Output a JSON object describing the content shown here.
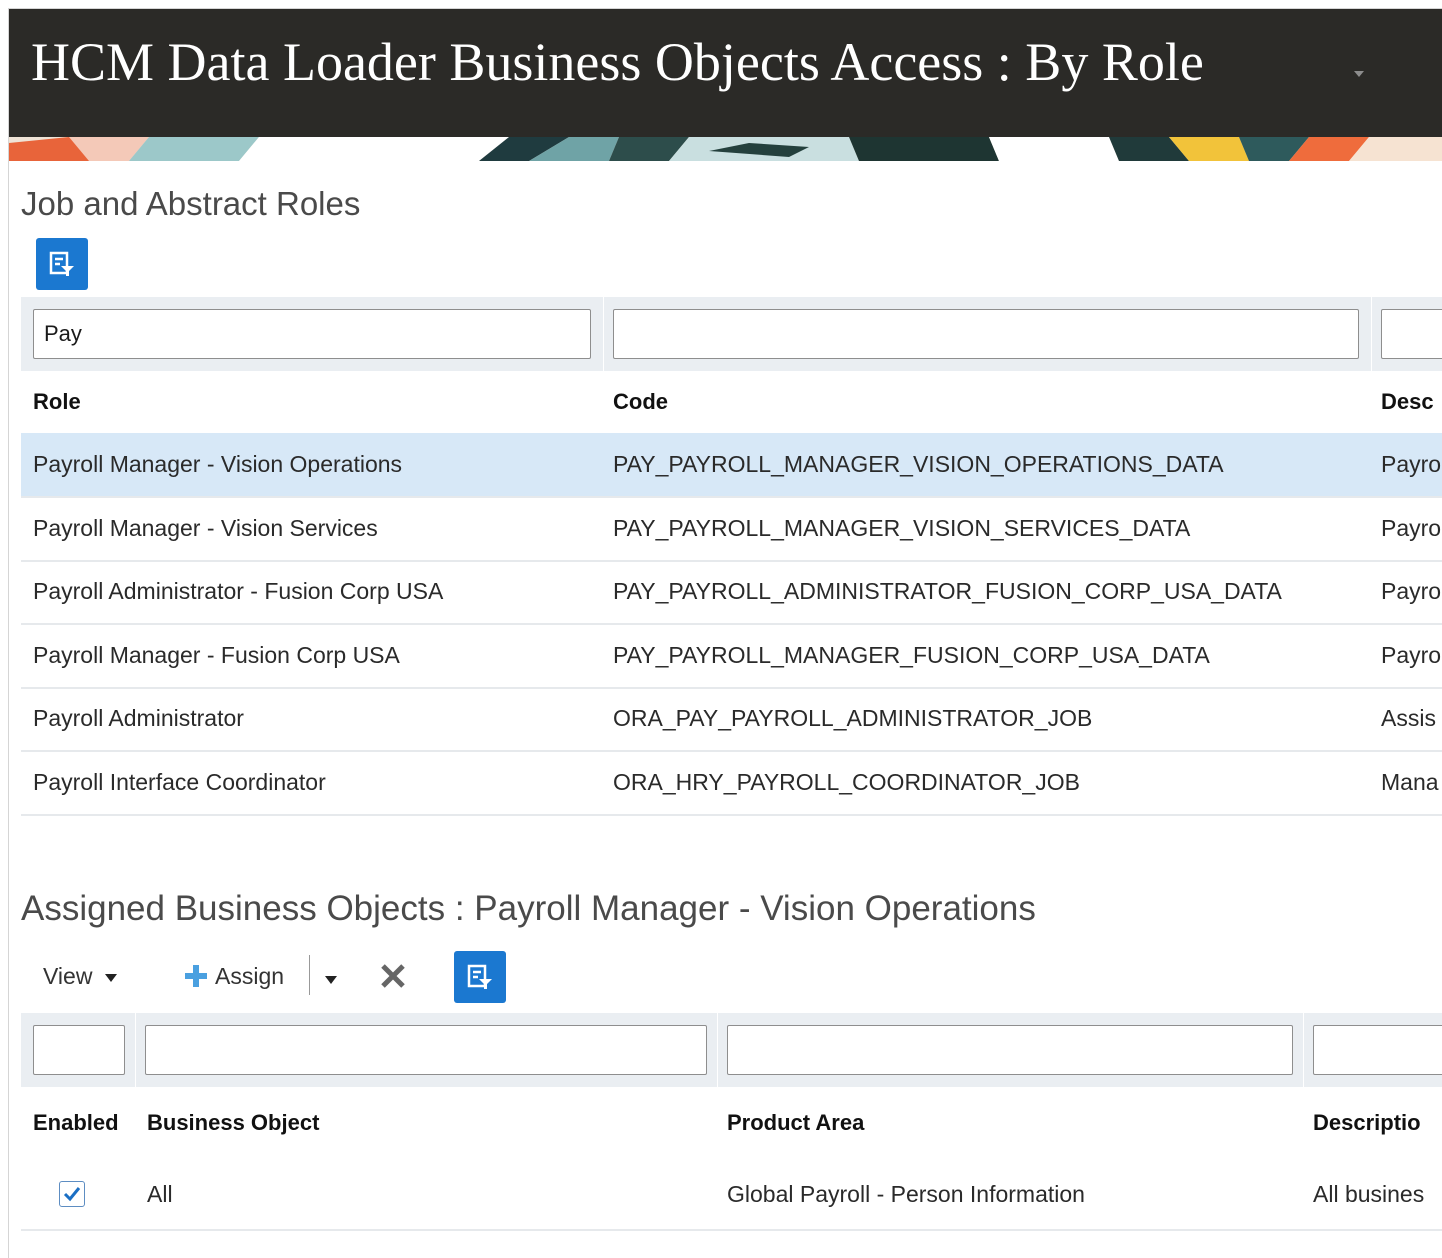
{
  "header": {
    "title": "HCM Data Loader Business Objects Access : By Role"
  },
  "roles_section": {
    "title": "Job and Abstract Roles",
    "filter_icon": "query-by-example-icon",
    "filters": {
      "role": "Pay",
      "code": "",
      "description": ""
    },
    "columns": {
      "role": "Role",
      "code": "Code",
      "description": "Desc"
    },
    "rows": [
      {
        "role": "Payroll Manager - Vision Operations",
        "code": "PAY_PAYROLL_MANAGER_VISION_OPERATIONS_DATA",
        "description": "Payro",
        "selected": true
      },
      {
        "role": "Payroll Manager - Vision Services",
        "code": "PAY_PAYROLL_MANAGER_VISION_SERVICES_DATA",
        "description": "Payro"
      },
      {
        "role": "Payroll Administrator - Fusion Corp USA",
        "code": "PAY_PAYROLL_ADMINISTRATOR_FUSION_CORP_USA_DATA",
        "description": "Payro"
      },
      {
        "role": "Payroll Manager - Fusion Corp USA",
        "code": "PAY_PAYROLL_MANAGER_FUSION_CORP_USA_DATA",
        "description": "Payro"
      },
      {
        "role": "Payroll Administrator",
        "code": "ORA_PAY_PAYROLL_ADMINISTRATOR_JOB",
        "description": "Assis"
      },
      {
        "role": "Payroll Interface Coordinator",
        "code": "ORA_HRY_PAYROLL_COORDINATOR_JOB",
        "description": "Mana"
      }
    ]
  },
  "assigned_section": {
    "title": "Assigned Business Objects : Payroll Manager - Vision Operations",
    "toolbar": {
      "view": "View",
      "assign": "Assign"
    },
    "icons": {
      "assign": "plus-icon",
      "delete": "close-x-icon",
      "filter": "query-by-example-icon"
    },
    "columns": {
      "enabled": "Enabled",
      "business_object": "Business Object",
      "product_area": "Product Area",
      "description": "Descriptio"
    },
    "rows": [
      {
        "enabled": true,
        "business_object": "All",
        "product_area": "Global Payroll - Person Information",
        "description": "All busines"
      }
    ]
  },
  "colors": {
    "titlebar": "#2b2a27",
    "accent": "#1b78d0",
    "selected_row": "#d7e8f7"
  }
}
